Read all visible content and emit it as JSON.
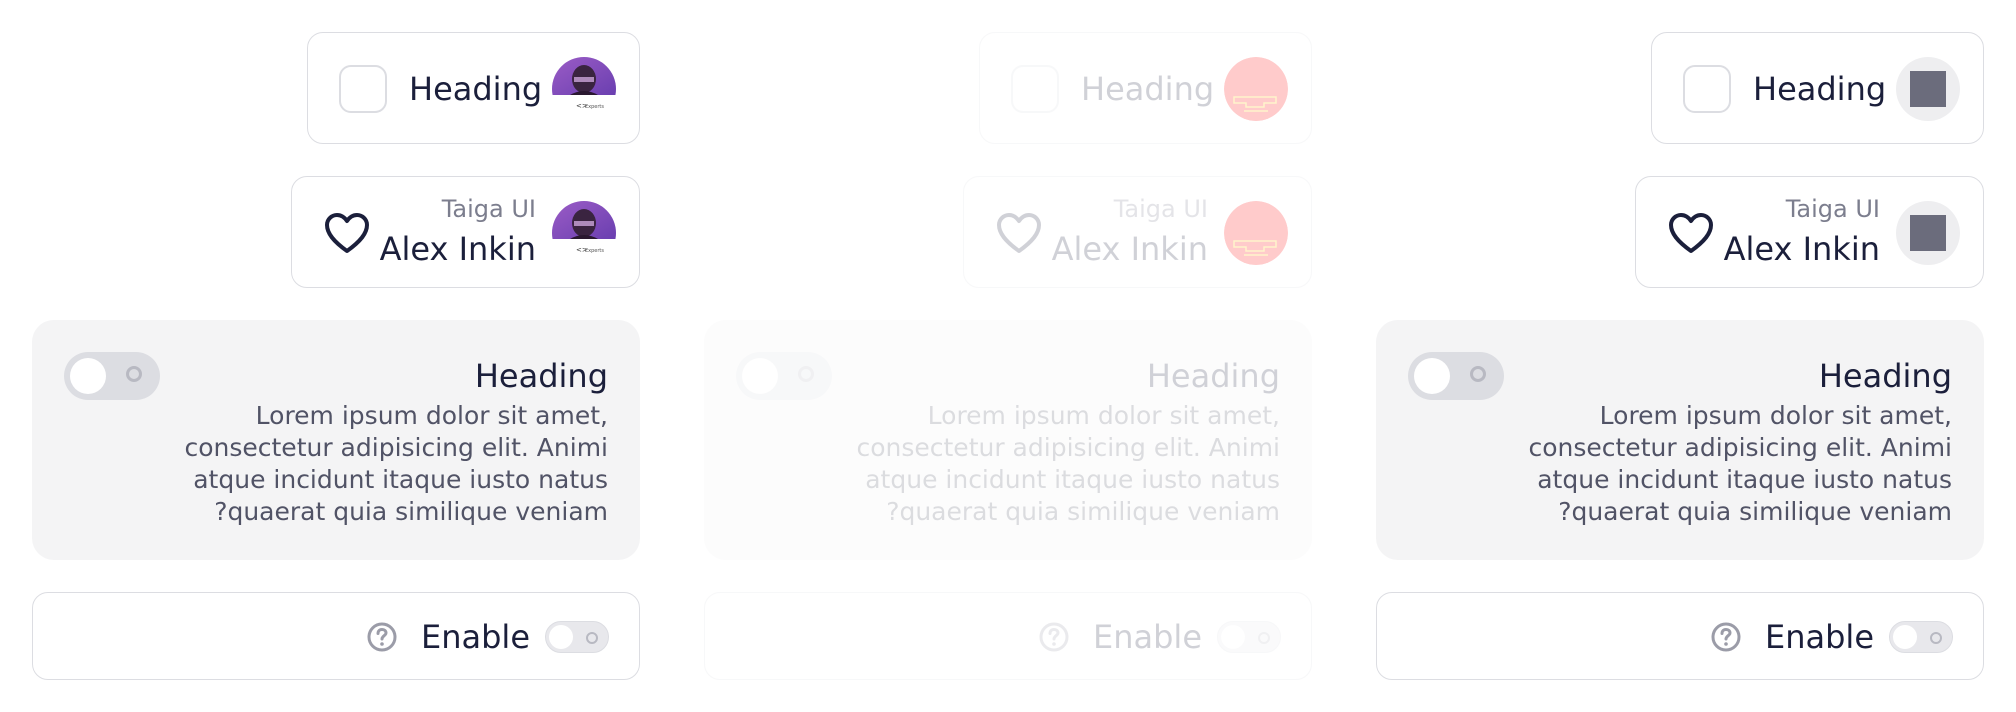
{
  "colors": {
    "text": "#1b1f3b",
    "secondary": "#7c7e8e",
    "border": "#dcdde2",
    "card_bg": "#f4f4f5",
    "icon": "#9b9ca8",
    "avatar_error": "#ff0000"
  },
  "columns": [
    {
      "state": "default",
      "avatar": "photo"
    },
    {
      "state": "disabled",
      "avatar": "broken-image"
    },
    {
      "state": "default",
      "avatar": "placeholder"
    }
  ],
  "card1": {
    "heading": "Heading"
  },
  "card2": {
    "caption": "Taiga UI",
    "name": "Alex Inkin"
  },
  "card3": {
    "heading": "Heading",
    "lines": [
      "Lorem ipsum dolor sit amet,",
      "consectetur adipisicing elit. Animi",
      "atque incidunt itaque iusto natus",
      "?quaerat quia similique veniam"
    ]
  },
  "card4": {
    "label": "Enable"
  },
  "icons": {
    "heart": "heart-icon",
    "help": "help-circle-icon"
  }
}
